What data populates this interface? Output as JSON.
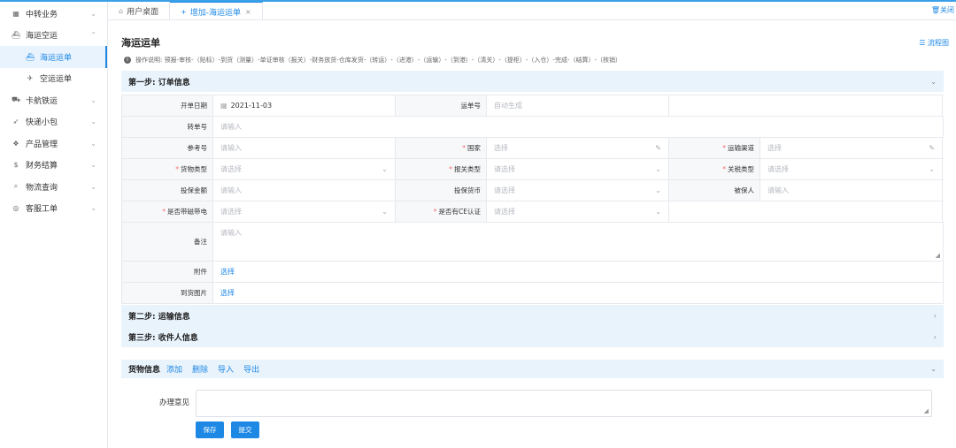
{
  "sidebar": {
    "items": [
      {
        "label": "中转业务",
        "icon": "building-icon"
      },
      {
        "label": "海运空运",
        "icon": "ship-icon"
      },
      {
        "label": "海运运单",
        "icon": "ship-icon"
      },
      {
        "label": "空运运单",
        "icon": "plane-icon"
      },
      {
        "label": "卡航铁运",
        "icon": "truck-icon"
      },
      {
        "label": "快递小包",
        "icon": "send-icon"
      },
      {
        "label": "产品管理",
        "icon": "products-icon"
      },
      {
        "label": "财务结算",
        "icon": "dollar-icon"
      },
      {
        "label": "物流查询",
        "icon": "search-icon"
      },
      {
        "label": "客服工单",
        "icon": "eye-icon"
      }
    ]
  },
  "tabs": {
    "items": [
      {
        "label": "用户桌面",
        "icon": "home-icon"
      },
      {
        "label": "增加-海运运单",
        "icon": "plus-icon"
      }
    ],
    "close_all": "关闭"
  },
  "page": {
    "title": "海运运单",
    "flow_link": "流程图",
    "note": "操作说明: 预报-审核-（贴标）-到货（测量）-单证审核（报关）-财务放货-仓库发货-（转运）-（进港）-（运输）-（到港）-（清关）-（提柜）-（入仓）-完成-（结算）-（核销）"
  },
  "step1": {
    "title": "第一步: 订单信息",
    "fields": {
      "order_date_label": "开单日期",
      "order_date_value": "2021-11-03",
      "waybill_no_label": "运单号",
      "waybill_no_ph": "自动生成",
      "transfer_no_label": "转单号",
      "transfer_no_ph": "请输入",
      "ref_no_label": "参考号",
      "ref_no_ph": "请输入",
      "country_label": "国家",
      "country_ph": "选择",
      "channel_label": "运输渠道",
      "channel_ph": "选择",
      "goods_type_label": "货物类型",
      "goods_type_ph": "请选择",
      "customs_type_label": "报关类型",
      "customs_type_ph": "请选择",
      "tax_type_label": "关税类型",
      "tax_type_ph": "请选择",
      "insured_amount_label": "投保金额",
      "insured_amount_ph": "请输入",
      "insured_currency_label": "投保货币",
      "insured_currency_ph": "请选择",
      "insured_person_label": "被保人",
      "insured_person_ph": "请输入",
      "magnetic_label": "是否带磁带电",
      "magnetic_ph": "请选择",
      "ce_label": "是否有CE认证",
      "ce_ph": "请选择",
      "remark_label": "备注",
      "remark_ph": "请输入",
      "attachment_label": "附件",
      "attachment_link": "选择",
      "arrival_photo_label": "到货图片",
      "arrival_photo_link": "选择"
    }
  },
  "step2": {
    "title": "第二步: 运输信息"
  },
  "step3": {
    "title": "第三步: 收件人信息"
  },
  "goods": {
    "title": "货物信息",
    "add": "添加",
    "delete": "删除",
    "import": "导入",
    "export": "导出"
  },
  "opinion": {
    "label": "办理意见"
  },
  "buttons": {
    "save": "保存",
    "submit": "提交"
  },
  "colors": {
    "accent": "#1e88e5",
    "section_bg": "#e9f3fc",
    "required": "#f56c6c"
  }
}
